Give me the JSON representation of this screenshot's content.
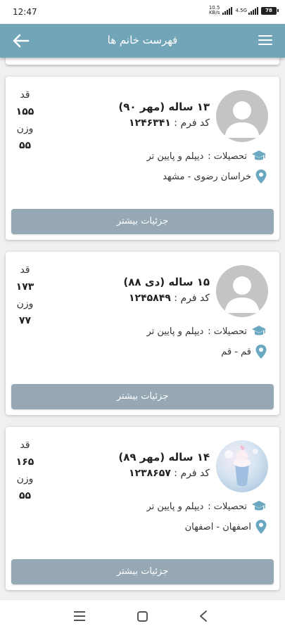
{
  "status_bar": {
    "time": "12:47",
    "net_speed_value": "10.5",
    "net_speed_unit": "KB/s",
    "network_type": "4.5G",
    "battery": "78"
  },
  "app_bar": {
    "title": "فهرست خانم ها",
    "menu_icon": "hamburger-menu-icon",
    "back_icon": "arrow-left-icon",
    "color": "#73a5b8"
  },
  "labels": {
    "height": "قد",
    "weight": "وزن",
    "code_prefix": "کد فرم :",
    "education_prefix": "تحصیلات :",
    "more_button": "جزئیات بیشتر"
  },
  "profiles": [
    {
      "age": "۱۳ ساله (مهر ۹۰)",
      "code": "۱۲۴۶۳۴۱",
      "education": "دیپلم و پایین تر",
      "location": "خراسان رضوی - مشهد",
      "height": "۱۵۵",
      "weight": "۵۵",
      "avatar": "default-avatar"
    },
    {
      "age": "۱۵ ساله (دی ۸۸)",
      "code": "۱۲۴۵۸۴۹",
      "education": "دیپلم و پایین تر",
      "location": "قم - قم",
      "height": "۱۷۳",
      "weight": "۷۷",
      "avatar": "default-avatar"
    },
    {
      "age": "۱۴ ساله (مهر ۸۹)",
      "code": "۱۲۳۸۶۵۷",
      "education": "دیپلم و پایین تر",
      "location": "اصفهان - اصفهان",
      "height": "۱۶۵",
      "weight": "۵۵",
      "avatar": "photo-avatar"
    }
  ],
  "colors": {
    "accent": "#73a5b8",
    "button": "#96a8b3",
    "icon": "#6aa7c0"
  }
}
